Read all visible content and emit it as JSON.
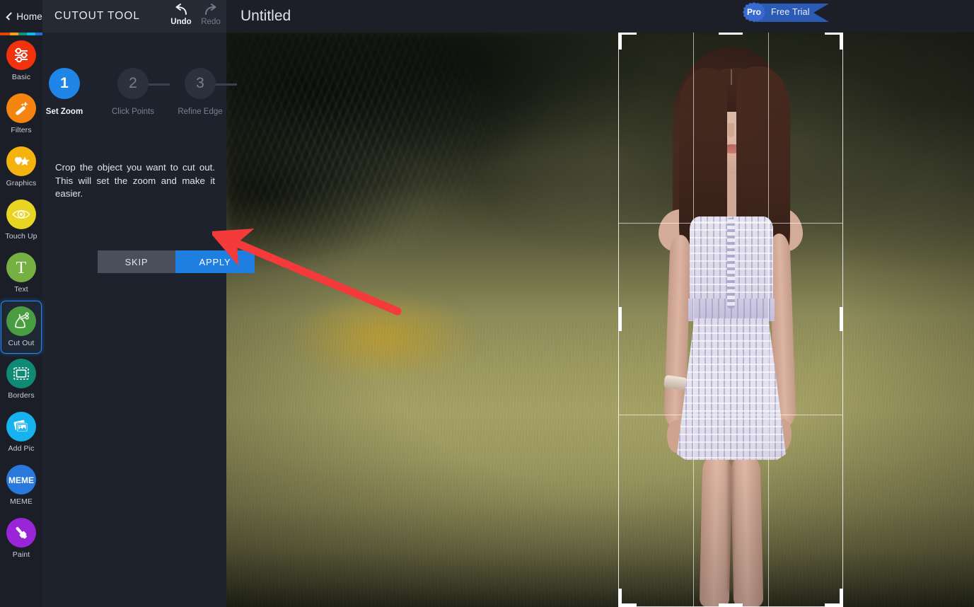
{
  "app": {
    "home_label": "Home",
    "tool_title": "CUTOUT TOOL",
    "document_title": "Untitled"
  },
  "topbar": {
    "undo_label": "Undo",
    "redo_label": "Redo",
    "pro_badge_label": "Pro",
    "free_trial_label": "Free Trial",
    "accent_blue": "#1f86e8",
    "ribbon_blue": "#2c5bb5"
  },
  "rail": {
    "accent_strip": [
      "#e8410b",
      "#f0a21d",
      "#11937b",
      "#14b6f0",
      "#1f6fe0"
    ],
    "items": [
      {
        "label": "Basic",
        "icon": "sliders-icon",
        "color": "#f2310d",
        "selected": false
      },
      {
        "label": "Filters",
        "icon": "wand-icon",
        "color": "#f58410",
        "selected": false
      },
      {
        "label": "Graphics",
        "icon": "heart-star-icon",
        "color": "#f5b310",
        "selected": false
      },
      {
        "label": "Touch Up",
        "icon": "eye-icon",
        "color": "#e8d422",
        "selected": false
      },
      {
        "label": "Text",
        "icon": "text-t-icon",
        "color": "#76b043",
        "selected": false
      },
      {
        "label": "Cut Out",
        "icon": "scissors-path-icon",
        "color": "#4a9c42",
        "selected": true
      },
      {
        "label": "Borders",
        "icon": "frame-icon",
        "color": "#0f8a76",
        "selected": false
      },
      {
        "label": "Add Pic",
        "icon": "photos-icon",
        "color": "#16b3ef",
        "selected": false
      },
      {
        "label": "MEME",
        "icon": "meme-icon",
        "color": "#2878dd",
        "selected": false
      },
      {
        "label": "Paint",
        "icon": "brush-icon",
        "color": "#9a25d8",
        "selected": false
      }
    ],
    "selection_color": "#1f8bff"
  },
  "panel": {
    "steps": [
      {
        "number": "1",
        "label": "Set Zoom",
        "state": "active"
      },
      {
        "number": "2",
        "label": "Click Points",
        "state": "idle"
      },
      {
        "number": "3",
        "label": "Refine Edge",
        "state": "idle"
      }
    ],
    "instructions": "Crop the object you want to cut out. This will set the zoom and make it easier.",
    "skip_label": "SKIP",
    "apply_label": "APPLY"
  },
  "canvas": {
    "image_description": "Young woman in a light lavender striped sundress standing on a grassy path with blurred green foliage behind her",
    "crop_overlay": {
      "visible": true,
      "grid": "rule-of-thirds",
      "handles": 8
    }
  },
  "annotation": {
    "arrow_color": "#f43a3a",
    "points_to": "apply-button"
  }
}
